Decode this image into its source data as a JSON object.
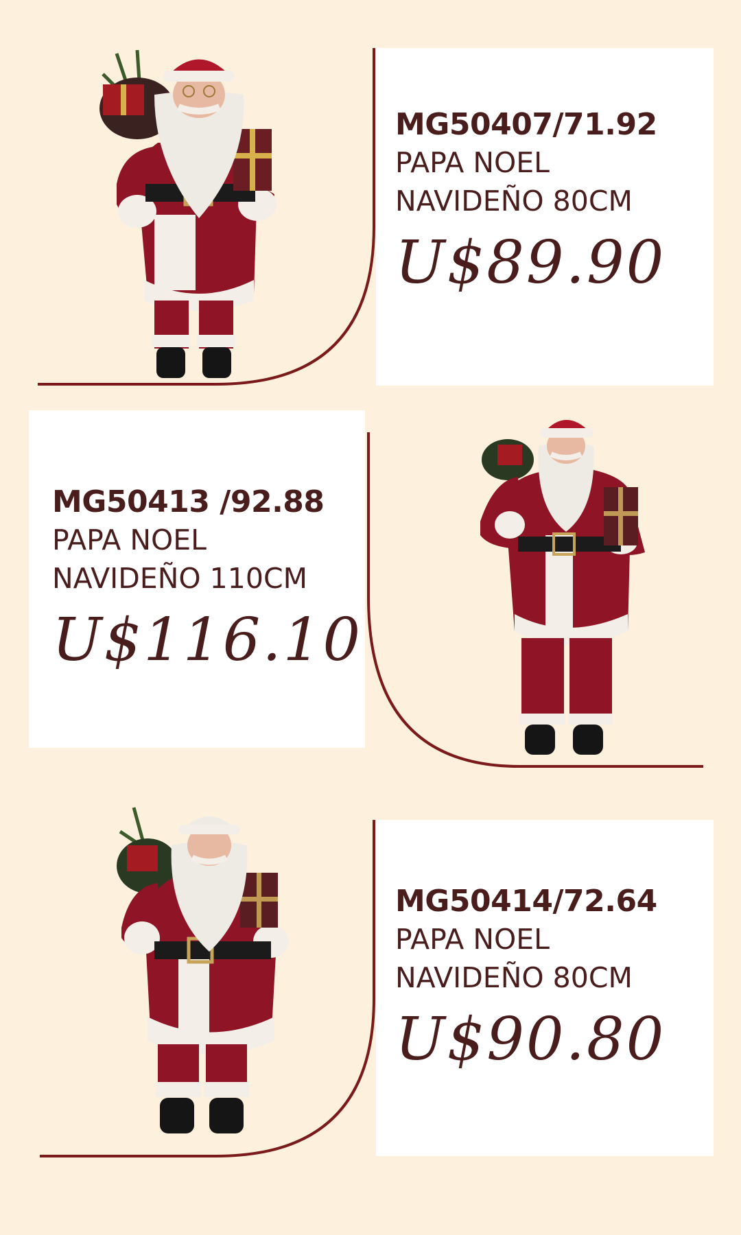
{
  "colors": {
    "background": "#fdf1dd",
    "card": "#ffffff",
    "text": "#4a1d1d",
    "accent_line": "#7a1a1a",
    "santa_red": "#8e1426"
  },
  "products": [
    {
      "code": "MG50407/71.92",
      "name_line1": "PAPA NOEL",
      "name_line2": "NAVIDEÑO 80CM",
      "price": "U$89.90",
      "image": "santa-figure-with-sack-and-gift"
    },
    {
      "code": "MG50413 /92.88",
      "name_line1": "PAPA NOEL",
      "name_line2": "NAVIDEÑO 110CM",
      "price": "U$116.10",
      "image": "santa-figure-with-sack-and-gift"
    },
    {
      "code": "MG50414/72.64",
      "name_line1": "PAPA NOEL",
      "name_line2": "NAVIDEÑO 80CM",
      "price": "U$90.80",
      "image": "santa-figure-with-sack-and-gift"
    }
  ]
}
